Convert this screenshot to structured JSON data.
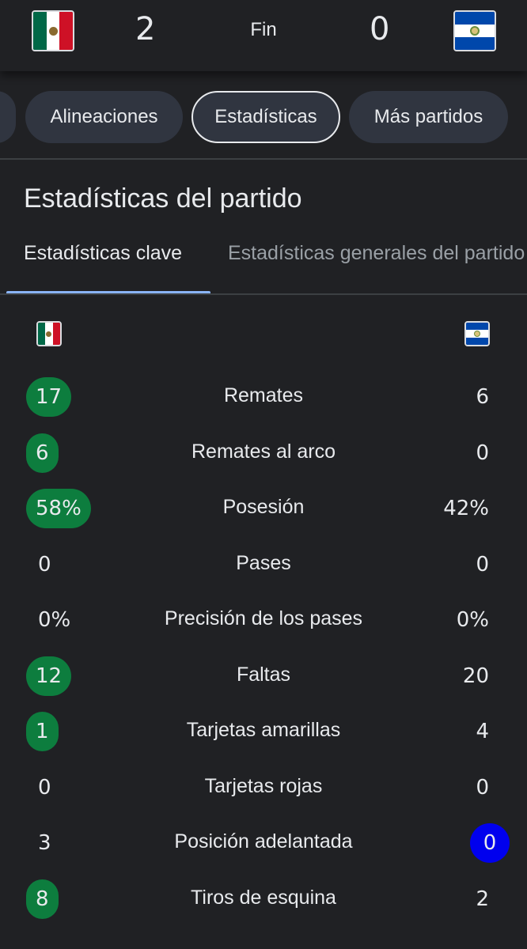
{
  "match": {
    "home_score": "2",
    "away_score": "0",
    "status": "Fin",
    "home_flag_icon": "mexico-flag-icon",
    "away_flag_icon": "el-salvador-flag-icon"
  },
  "chips": [
    {
      "label": "Alineaciones",
      "selected": false
    },
    {
      "label": "Estadísticas",
      "selected": true
    },
    {
      "label": "Más partidos",
      "selected": false
    }
  ],
  "section": {
    "title": "Estadísticas del partido",
    "tabs": [
      {
        "label": "Estadísticas clave",
        "active": true
      },
      {
        "label": "Estadísticas generales del partido",
        "active": false
      }
    ]
  },
  "stats": [
    {
      "label": "Remates",
      "home": "17",
      "away": "6",
      "highlight": "home"
    },
    {
      "label": "Remates al arco",
      "home": "6",
      "away": "0",
      "highlight": "home"
    },
    {
      "label": "Posesión",
      "home": "58%",
      "away": "42%",
      "highlight": "home"
    },
    {
      "label": "Pases",
      "home": "0",
      "away": "0",
      "highlight": "none"
    },
    {
      "label": "Precisión de los pases",
      "home": "0%",
      "away": "0%",
      "highlight": "none"
    },
    {
      "label": "Faltas",
      "home": "12",
      "away": "20",
      "highlight": "home"
    },
    {
      "label": "Tarjetas amarillas",
      "home": "1",
      "away": "4",
      "highlight": "home"
    },
    {
      "label": "Tarjetas rojas",
      "home": "0",
      "away": "0",
      "highlight": "none"
    },
    {
      "label": "Posición adelantada",
      "home": "3",
      "away": "0",
      "highlight": "away-blue"
    },
    {
      "label": "Tiros de esquina",
      "home": "8",
      "away": "2",
      "highlight": "home"
    }
  ],
  "colors": {
    "background": "#202124",
    "win_badge": "#0d7d3e",
    "blue_badge": "#0000ee",
    "chip_bg": "#303540",
    "tab_underline": "#8ab4f8"
  }
}
